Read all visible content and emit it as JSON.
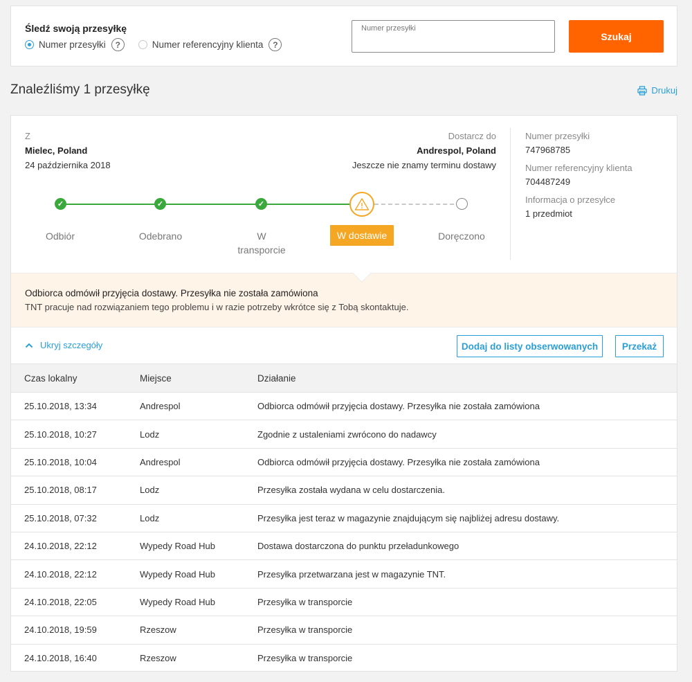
{
  "search": {
    "title": "Śledź swoją przesyłkę",
    "radio_options": [
      {
        "label": "Numer przesyłki",
        "checked": true
      },
      {
        "label": "Numer referencyjny klienta",
        "checked": false
      }
    ],
    "field_label": "Numer przesyłki",
    "field_value": "",
    "button_label": "Szukaj"
  },
  "result": {
    "title": "Znaleźliśmy 1 przesyłkę",
    "print_label": "Drukuj"
  },
  "shipment": {
    "from_label": "Z",
    "from_city": "Mielec, Poland",
    "from_date": "24 października 2018",
    "to_label": "Dostarcz do",
    "to_city": "Andrespol, Poland",
    "to_date": "Jeszcze nie znamy terminu dostawy",
    "info": [
      {
        "label": "Numer przesyłki",
        "value": "747968785"
      },
      {
        "label": "Numer referencyjny klienta",
        "value": "704487249"
      },
      {
        "label": "Informacja o przesyłce",
        "value": "1 przedmiot"
      }
    ],
    "steps": [
      {
        "label": "Odbiór",
        "state": "done"
      },
      {
        "label": "Odebrano",
        "state": "done"
      },
      {
        "label": "W transporcie",
        "state": "done"
      },
      {
        "label": "W dostawie",
        "state": "warning"
      },
      {
        "label": "Doręczono",
        "state": "pending"
      }
    ]
  },
  "alert": {
    "title": "Odbiorca odmówił przyjęcia dostawy. Przesyłka nie została zamówiona",
    "text": "TNT pracuje nad rozwiązaniem tego problemu i w razie potrzeby wkrótce się z Tobą skontaktuje."
  },
  "actions": {
    "toggle_label": "Ukryj szczegóły",
    "watch_label": "Dodaj do listy obserwowanych",
    "forward_label": "Przekaż"
  },
  "table": {
    "columns": [
      "Czas lokalny",
      "Miejsce",
      "Działanie"
    ],
    "rows": [
      [
        "25.10.2018, 13:34",
        "Andrespol",
        "Odbiorca odmówił przyjęcia dostawy. Przesyłka nie została zamówiona"
      ],
      [
        "25.10.2018, 10:27",
        "Lodz",
        "Zgodnie z ustaleniami zwrócono do nadawcy"
      ],
      [
        "25.10.2018, 10:04",
        "Andrespol",
        "Odbiorca odmówił przyjęcia dostawy. Przesyłka nie została zamówiona"
      ],
      [
        "25.10.2018, 08:17",
        "Lodz",
        "Przesyłka została wydana w celu dostarczenia."
      ],
      [
        "25.10.2018, 07:32",
        "Lodz",
        "Przesyłka jest teraz w magazynie znajdującym się najbliżej adresu dostawy."
      ],
      [
        "24.10.2018, 22:12",
        "Wypedy Road Hub",
        "Dostawa dostarczona do punktu przeładunkowego"
      ],
      [
        "24.10.2018, 22:12",
        "Wypedy Road Hub",
        "Przesyłka przetwarzana jest w magazynie TNT."
      ],
      [
        "24.10.2018, 22:05",
        "Wypedy Road Hub",
        "Przesyłka w transporcie"
      ],
      [
        "24.10.2018, 19:59",
        "Rzeszow",
        "Przesyłka w transporcie"
      ],
      [
        "24.10.2018, 16:40",
        "Rzeszow",
        "Przesyłka w transporcie"
      ]
    ]
  },
  "colors": {
    "accent": "#ff6400",
    "link": "#2a9fd8",
    "done": "#3aa83a",
    "warning": "#f5a623",
    "alert_bg": "#fff4e8"
  }
}
